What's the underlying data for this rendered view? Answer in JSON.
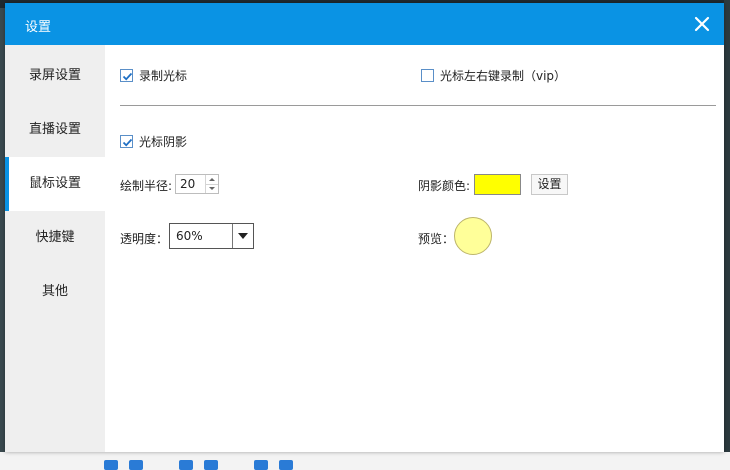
{
  "window": {
    "title": "设置"
  },
  "sidebar": {
    "items": [
      {
        "label": "录屏设置"
      },
      {
        "label": "直播设置"
      },
      {
        "label": "鼠标设置"
      },
      {
        "label": "快捷键"
      },
      {
        "label": "其他"
      }
    ],
    "active_index": 2
  },
  "mouse": {
    "record_cursor": {
      "label": "录制光标",
      "checked": true
    },
    "record_clicks": {
      "label": "光标左右键录制（vip）",
      "checked": false
    },
    "cursor_shadow": {
      "label": "光标阴影",
      "checked": true
    },
    "radius": {
      "label": "绘制半径:",
      "value": "20"
    },
    "shadow_color": {
      "label": "阴影颜色:",
      "color": "#ffff00",
      "button": "设置"
    },
    "opacity": {
      "label": "透明度：",
      "value": "60%"
    },
    "preview": {
      "label": "预览：",
      "color": "#ffff99"
    }
  },
  "colors": {
    "accent": "#0a93e4"
  }
}
